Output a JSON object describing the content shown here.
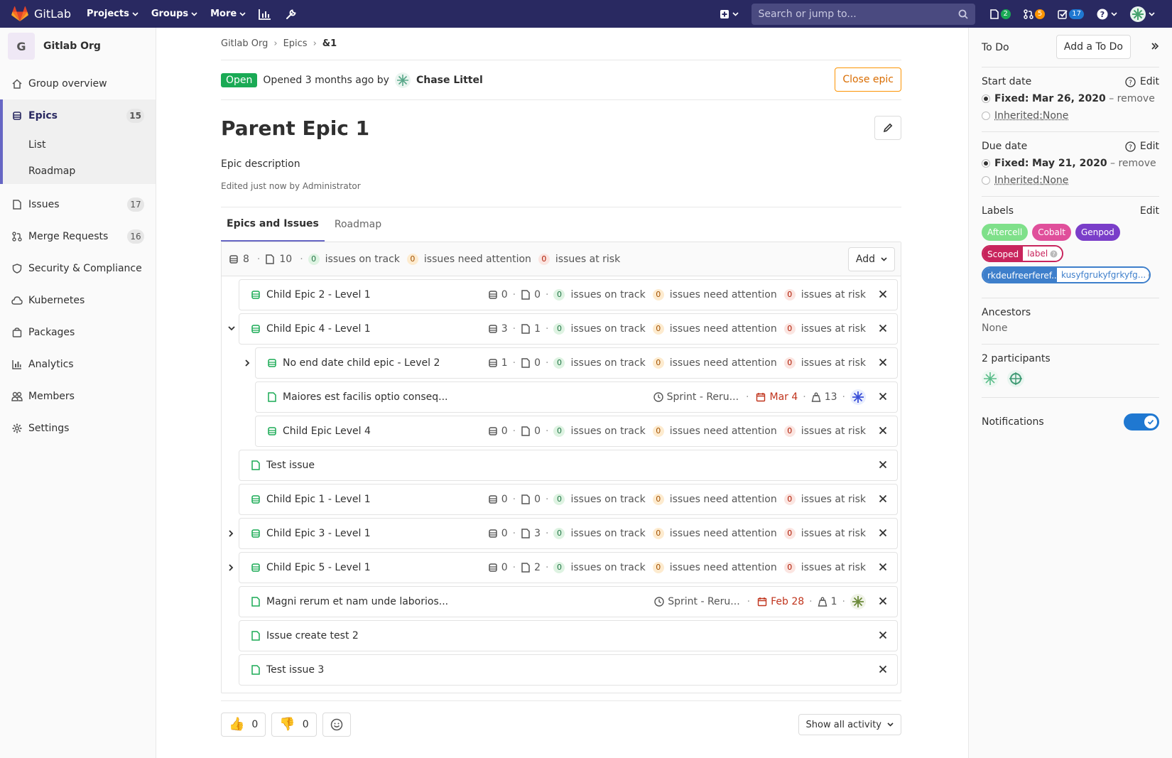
{
  "topnav": {
    "brand": "GitLab",
    "links": [
      "Projects",
      "Groups",
      "More"
    ],
    "search_placeholder": "Search or jump to...",
    "issues_count": "2",
    "mr_count": "5",
    "todos_count": "17"
  },
  "sidebar": {
    "org_initial": "G",
    "org_name": "Gitlab Org",
    "group_overview": "Group overview",
    "epics": "Epics",
    "epics_count": "15",
    "epics_list": "List",
    "epics_roadmap": "Roadmap",
    "issues": "Issues",
    "issues_count": "17",
    "merge_requests": "Merge Requests",
    "mr_count": "16",
    "security": "Security & Compliance",
    "kubernetes": "Kubernetes",
    "packages": "Packages",
    "analytics": "Analytics",
    "members": "Members",
    "settings": "Settings"
  },
  "breadcrumb": [
    "Gitlab Org",
    "Epics",
    "&1"
  ],
  "epic": {
    "status": "Open",
    "opened_text": "Opened 3 months ago by",
    "author": "Chase Littel",
    "close_label": "Close epic",
    "title": "Parent Epic 1",
    "description": "Epic description",
    "edited": "Edited just now by Administrator"
  },
  "tabs": [
    "Epics and Issues",
    "Roadmap"
  ],
  "tree_header": {
    "epics_count": "8",
    "issues_count": "10",
    "on_track": "0",
    "on_track_label": "issues on track",
    "attention": "0",
    "attention_label": "issues need attention",
    "at_risk": "0",
    "at_risk_label": "issues at risk",
    "add_label": "Add"
  },
  "rows": [
    {
      "type": "epic",
      "title": "Child Epic 2 - Level 1",
      "epics": "0",
      "issues": "0",
      "on_track": "0",
      "attention": "0",
      "risk": "0"
    },
    {
      "type": "epic",
      "title": "Child Epic 4 - Level 1",
      "epics": "3",
      "issues": "1",
      "on_track": "0",
      "attention": "0",
      "risk": "0"
    },
    {
      "type": "epic",
      "title": "No end date child epic - Level 2",
      "epics": "1",
      "issues": "0",
      "on_track": "0",
      "attention": "0",
      "risk": "0"
    },
    {
      "type": "issue",
      "title": "Maiores est facilis optio conseq...",
      "milestone": "Sprint - Reru...",
      "due": "Mar 4",
      "weight": "13"
    },
    {
      "type": "epic",
      "title": "Child Epic Level 4",
      "epics": "0",
      "issues": "0",
      "on_track": "0",
      "attention": "0",
      "risk": "0"
    },
    {
      "type": "issue",
      "title": "Test issue"
    },
    {
      "type": "epic",
      "title": "Child Epic 1 - Level 1",
      "epics": "0",
      "issues": "0",
      "on_track": "0",
      "attention": "0",
      "risk": "0"
    },
    {
      "type": "epic",
      "title": "Child Epic 3 - Level 1",
      "epics": "0",
      "issues": "3",
      "on_track": "0",
      "attention": "0",
      "risk": "0"
    },
    {
      "type": "epic",
      "title": "Child Epic 5 - Level 1",
      "epics": "0",
      "issues": "2",
      "on_track": "0",
      "attention": "0",
      "risk": "0"
    },
    {
      "type": "issue",
      "title": "Magni rerum et nam unde laborios...",
      "milestone": "Sprint - Reru...",
      "due": "Feb 28",
      "weight": "1"
    },
    {
      "type": "issue",
      "title": "Issue create test 2"
    },
    {
      "type": "issue",
      "title": "Test issue 3"
    }
  ],
  "labels_text": {
    "on_track": "issues on track",
    "attention": "issues need attention",
    "risk": "issues at risk"
  },
  "reactions": {
    "thumbs_up": "0",
    "thumbs_down": "0"
  },
  "show_activity": "Show all activity",
  "right_sidebar": {
    "todo_label": "To Do",
    "add_todo": "Add a To Do",
    "start_date": "Start date",
    "edit": "Edit",
    "start_fixed_prefix": "Fixed:",
    "start_fixed": "Mar 26, 2020",
    "remove": "– remove",
    "inherited": "Inherited:",
    "inherited_none": "None",
    "due_date": "Due date",
    "due_fixed": "May 21, 2020",
    "labels": "Labels",
    "label_aftercell": "Aftercell",
    "label_cobalt": "Cobalt",
    "label_genpod": "Genpod",
    "scoped_key": "Scoped",
    "scoped_val": "label",
    "scoped2_key": "rkdeufreerferef...",
    "scoped2_val": "kusyfgrukyfgrkyfg...",
    "ancestors": "Ancestors",
    "ancestors_value": "None",
    "participants": "2 participants",
    "notifications": "Notifications"
  },
  "colors": {
    "nav_bg": "#292961",
    "accent": "#6666c4",
    "open": "#1aaa55",
    "aftercell": "#7fe08a",
    "cobalt": "#e04f9b",
    "genpod": "#7a3ec9",
    "scoped": "#c8245c",
    "scoped2": "#3e7fcb"
  }
}
